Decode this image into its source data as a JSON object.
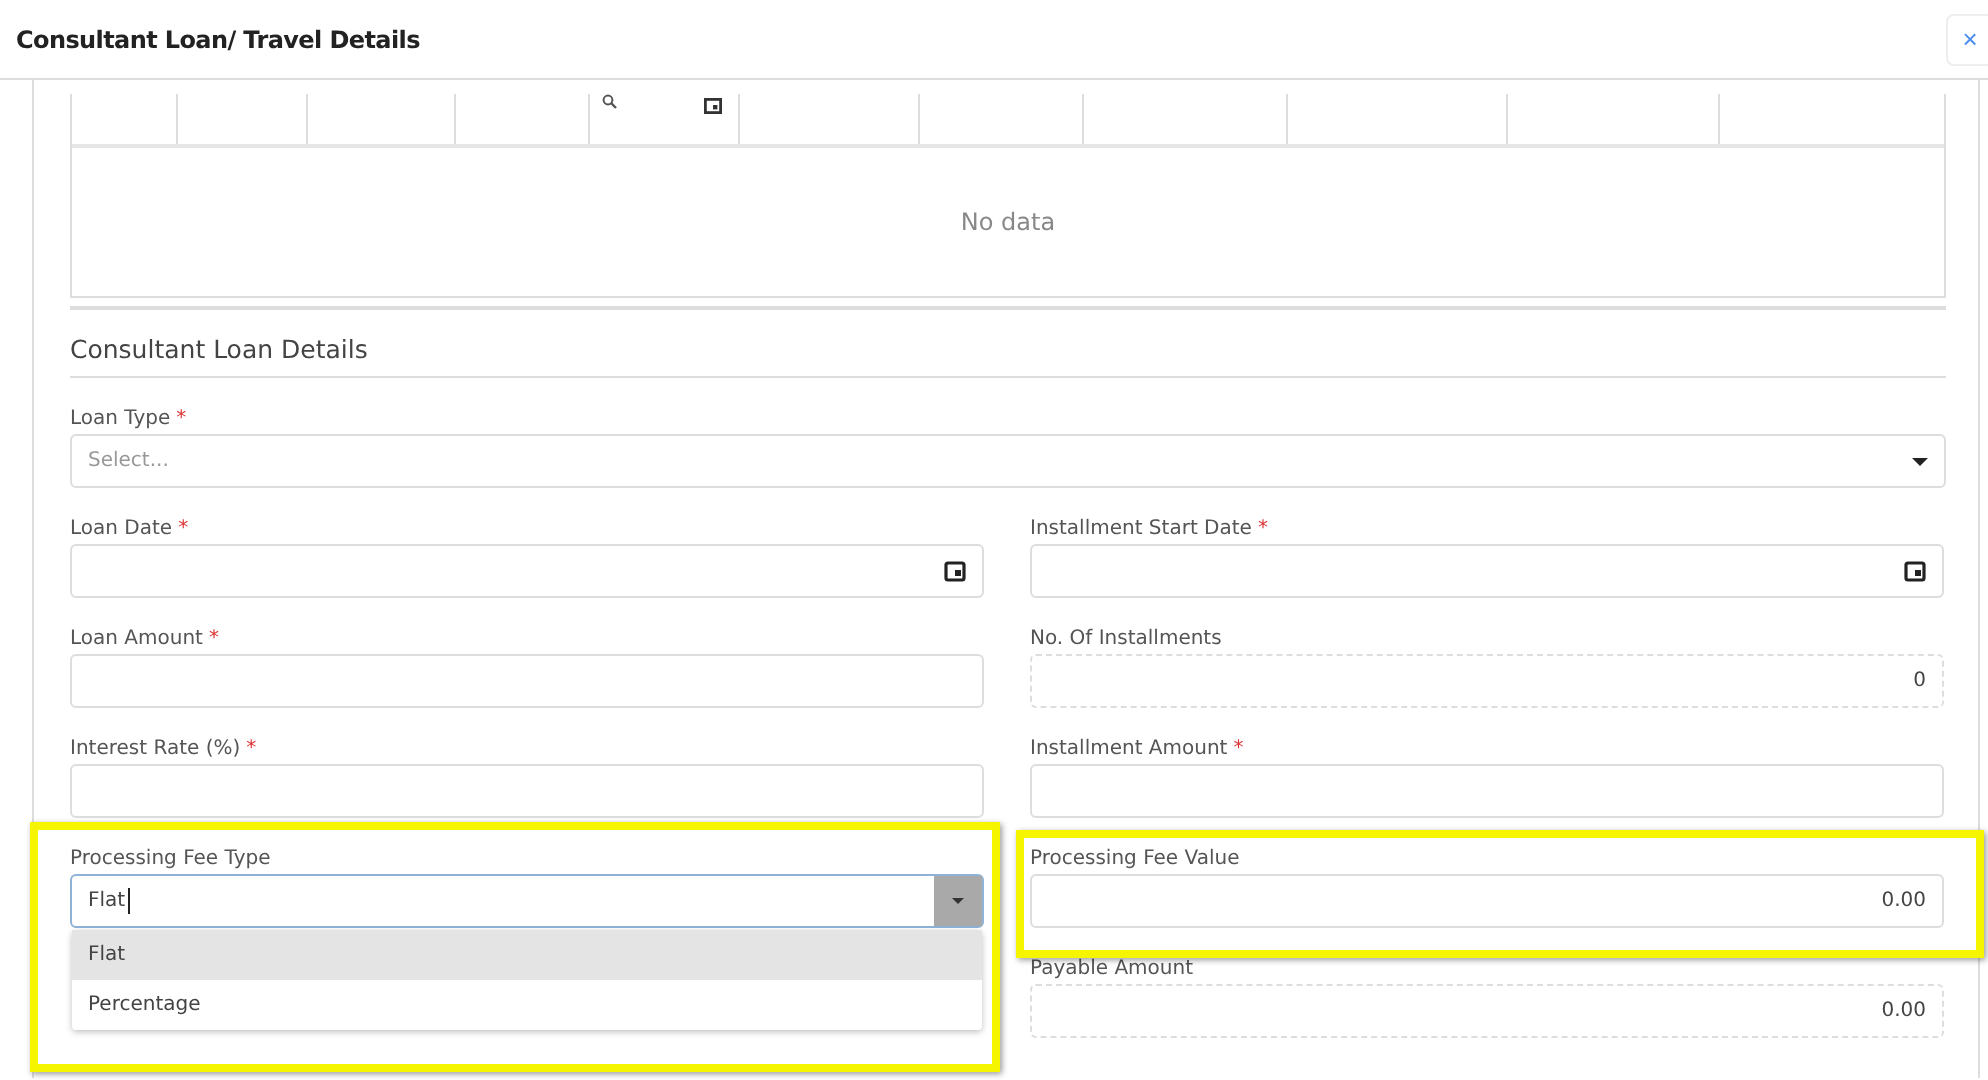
{
  "dialog": {
    "title": "Consultant Loan/ Travel Details",
    "close": "×"
  },
  "table": {
    "empty_text": "No data"
  },
  "section": {
    "title": "Consultant Loan Details"
  },
  "loan_type": {
    "label": "Loan Type",
    "required_mark": "*",
    "placeholder": "Select...",
    "kind": "select"
  },
  "left_fields": [
    {
      "label": "Loan Date",
      "required_mark": "*",
      "kind": "date",
      "highlighted": false
    },
    {
      "label": "Loan Amount",
      "required_mark": "*",
      "kind": "text",
      "highlighted": false
    },
    {
      "label": "Interest Rate (%)",
      "required_mark": "*",
      "kind": "text",
      "highlighted": false
    },
    {
      "label": "Processing Fee Type",
      "kind": "combo",
      "value": "Flat",
      "highlighted": true,
      "expanded": true,
      "options": [
        {
          "label": "Flat",
          "selected": true
        },
        {
          "label": "Percentage",
          "selected": false
        }
      ]
    }
  ],
  "right_fields": [
    {
      "label": "Installment Start Date",
      "required_mark": "*",
      "kind": "date",
      "highlighted": false
    },
    {
      "label": "No. Of Installments",
      "kind": "readonly",
      "value": "0",
      "highlighted": false
    },
    {
      "label": "Installment Amount",
      "required_mark": "*",
      "kind": "text",
      "highlighted": false
    },
    {
      "label": "Processing Fee Value",
      "kind": "text",
      "value": "0.00",
      "highlighted": true
    },
    {
      "label": "Payable Amount",
      "kind": "readonly",
      "value": "0.00",
      "highlighted": false
    }
  ]
}
